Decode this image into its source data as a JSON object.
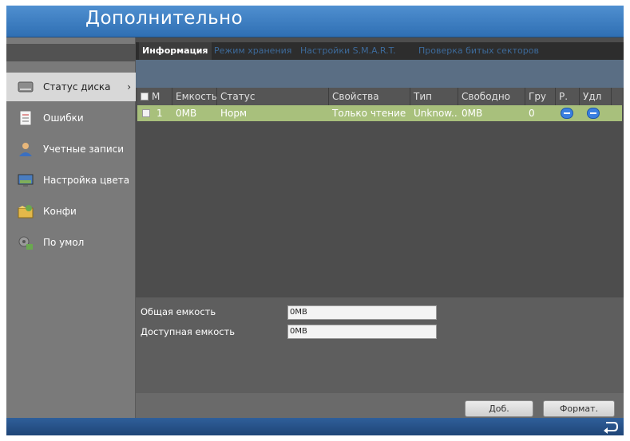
{
  "window": {
    "title": "Дополнительно"
  },
  "sidebar": {
    "items": [
      {
        "label": "Статус диска",
        "icon": "hdd-icon",
        "active": true
      },
      {
        "label": "Ошибки",
        "icon": "log-icon"
      },
      {
        "label": "Учетные записи",
        "icon": "user-icon"
      },
      {
        "label": "Настройка цвета",
        "icon": "display-icon"
      },
      {
        "label": "Конфи",
        "icon": "config-icon"
      },
      {
        "label": "По умол",
        "icon": "default-icon"
      }
    ],
    "chevron": "›"
  },
  "tabs": [
    {
      "label": "Информация",
      "active": true
    },
    {
      "label": "Режим хранения"
    },
    {
      "label": "Настройки S.M.A.R.T."
    },
    {
      "label": "Проверка битых секторов"
    }
  ],
  "table": {
    "columns": [
      "M",
      "Емкость",
      "Статус",
      "Свойства",
      "Тип",
      "Свободно",
      "Гру",
      "Р.",
      "Удл"
    ],
    "rows": [
      {
        "num": "1",
        "capacity": "0MB",
        "status": "Норм",
        "property": "Только чтение",
        "type": "Unknow...",
        "free": "0MB",
        "group": "0"
      }
    ]
  },
  "info": {
    "total_label": "Общая емкость",
    "total_value": "0MB",
    "available_label": "Доступная емкость",
    "available_value": "0MB"
  },
  "buttons": {
    "add": "Доб.",
    "format": "Формат."
  },
  "colors": {
    "title_bar": "#3f7fc2",
    "row_highlight": "#a8c07c",
    "tab_inactive_text": "#3d6a9a",
    "accent_button": "#3a7fe0"
  }
}
